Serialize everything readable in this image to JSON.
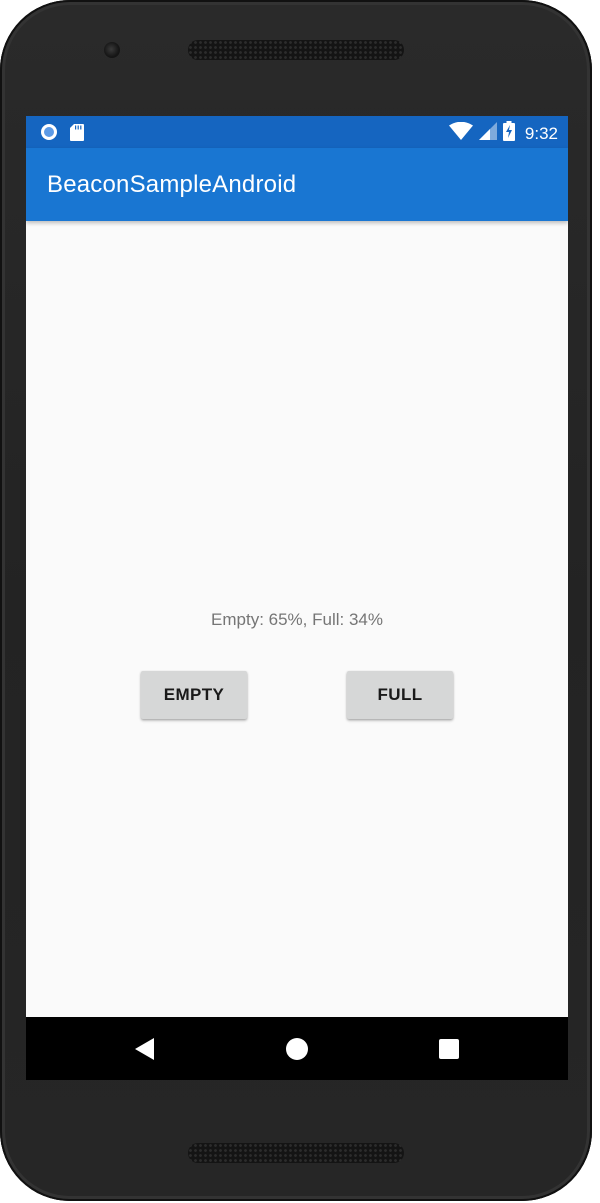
{
  "status_bar": {
    "time": "9:32",
    "left_icons": [
      "circle-notification-icon",
      "sd-card-icon"
    ],
    "right_icons": [
      "wifi-icon",
      "cell-signal-icon",
      "battery-charging-icon"
    ],
    "color": "#1565c0"
  },
  "app_bar": {
    "title": "BeaconSampleAndroid",
    "color": "#1976d2"
  },
  "main": {
    "status_text": "Empty: 65%, Full: 34%",
    "buttons": {
      "empty_label": "EMPTY",
      "full_label": "FULL"
    }
  },
  "nav_bar": {
    "icons": [
      "back-icon",
      "home-icon",
      "recents-icon"
    ]
  }
}
